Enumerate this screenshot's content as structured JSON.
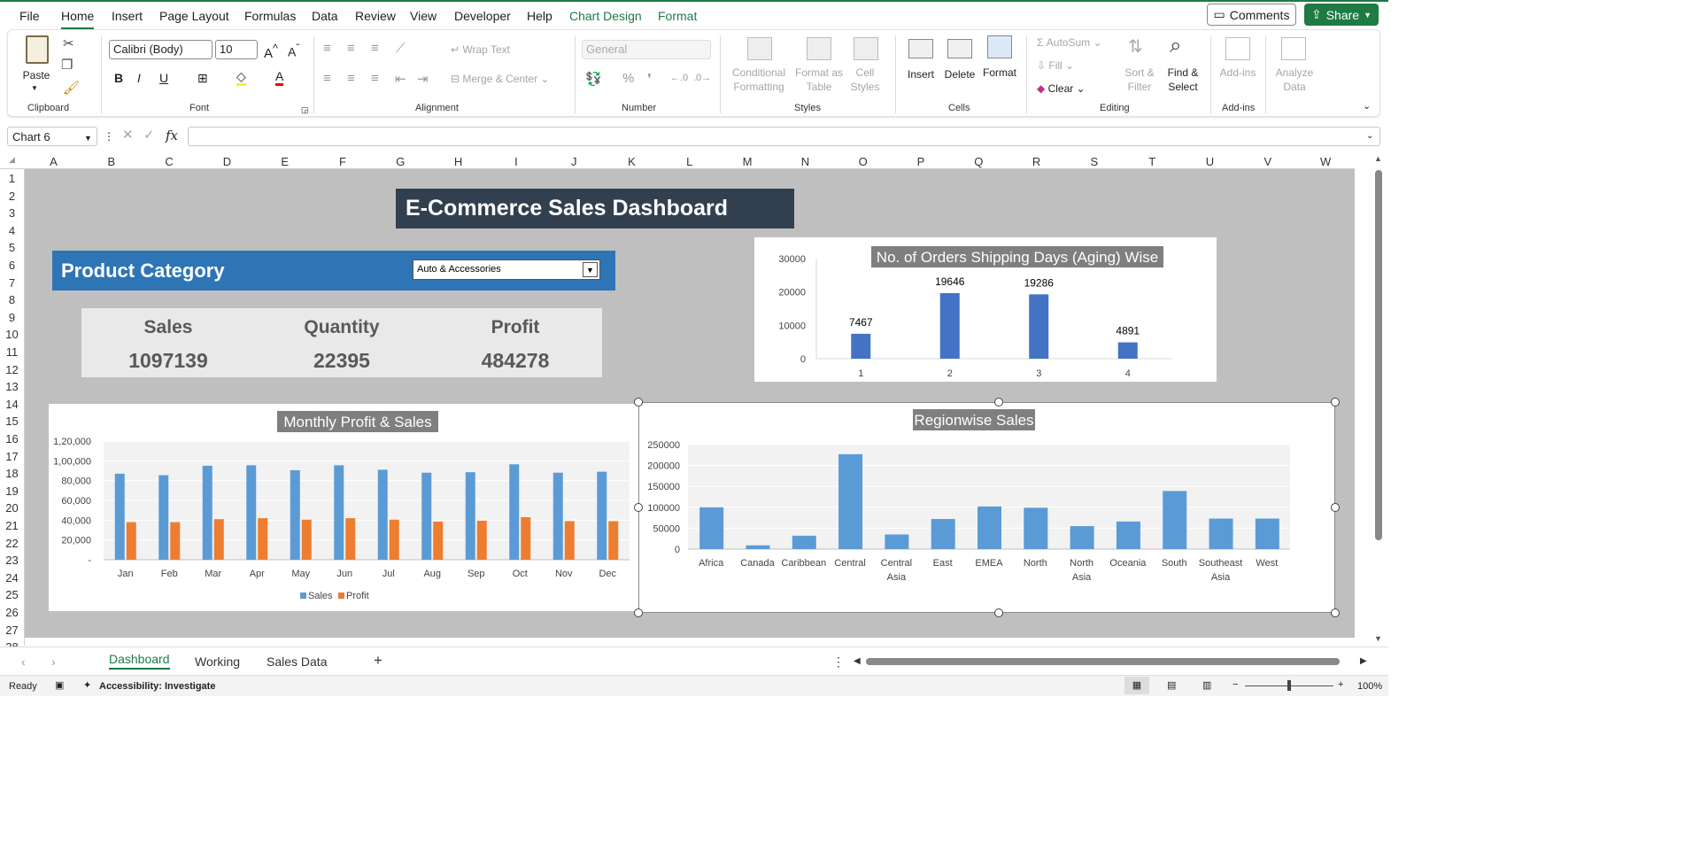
{
  "menu": {
    "tabs": [
      "File",
      "Home",
      "Insert",
      "Page Layout",
      "Formulas",
      "Data",
      "Review",
      "View",
      "Developer",
      "Help",
      "Chart Design",
      "Format"
    ],
    "comments": "Comments",
    "share": "Share"
  },
  "ribbon": {
    "paste": "Paste",
    "clipboard": "Clipboard",
    "font_name": "Calibri (Body)",
    "font_size": "10",
    "font": "Font",
    "wrap_text": "Wrap Text",
    "merge_center": "Merge & Center",
    "alignment": "Alignment",
    "number_format": "General",
    "number": "Number",
    "conditional_formatting": "Conditional Formatting",
    "format_as_table": "Format as Table",
    "cell_styles": "Cell Styles",
    "styles": "Styles",
    "insert": "Insert",
    "delete": "Delete",
    "format": "Format",
    "cells": "Cells",
    "autosum": "AutoSum",
    "fill": "Fill",
    "clear": "Clear",
    "sort_filter": "Sort & Filter",
    "find_select": "Find & Select",
    "editing": "Editing",
    "add_ins": "Add-ins",
    "add_ins_group": "Add-ins",
    "analyze_data": "Analyze Data"
  },
  "formula_bar": {
    "name_box": "Chart 6",
    "fx": "fx"
  },
  "columns": [
    "A",
    "B",
    "C",
    "D",
    "E",
    "F",
    "G",
    "H",
    "I",
    "J",
    "K",
    "L",
    "M",
    "N",
    "O",
    "P",
    "Q",
    "R",
    "S",
    "T",
    "U",
    "V",
    "W"
  ],
  "rows": [
    "1",
    "2",
    "3",
    "4",
    "5",
    "6",
    "7",
    "8",
    "9",
    "10",
    "11",
    "12",
    "13",
    "14",
    "15",
    "16",
    "17",
    "18",
    "19",
    "20",
    "21",
    "22",
    "23",
    "24",
    "25",
    "26",
    "27",
    "28"
  ],
  "dashboard": {
    "title": "E-Commerce Sales Dashboard",
    "category_label": "Product Category",
    "category_value": "Auto & Accessories",
    "kpis": [
      {
        "label": "Sales",
        "value": "1097139"
      },
      {
        "label": "Quantity",
        "value": "22395"
      },
      {
        "label": "Profit",
        "value": "484278"
      }
    ]
  },
  "chart_data": [
    {
      "type": "bar",
      "title": "No. of Orders Shipping Days (Aging) Wise",
      "categories": [
        "1",
        "2",
        "3",
        "4"
      ],
      "values": [
        7467,
        19646,
        19286,
        4891
      ],
      "ylim": [
        0,
        30000
      ],
      "yticks": [
        "30000",
        "20000",
        "10000",
        "0"
      ],
      "color": "#4472c4"
    },
    {
      "type": "bar",
      "title": "Monthly Profit & Sales",
      "categories": [
        "Jan",
        "Feb",
        "Mar",
        "Apr",
        "May",
        "Jun",
        "Jul",
        "Aug",
        "Sep",
        "Oct",
        "Nov",
        "Dec"
      ],
      "series": [
        {
          "name": "Sales",
          "values": [
            87000,
            85500,
            95000,
            95500,
            90500,
            95500,
            91000,
            88000,
            88500,
            96500,
            88000,
            89000
          ],
          "color": "#5b9bd5"
        },
        {
          "name": "Profit",
          "values": [
            38000,
            38000,
            41000,
            42000,
            40500,
            42000,
            40500,
            38500,
            39500,
            43000,
            39000,
            39000
          ],
          "color": "#ed7d31"
        }
      ],
      "ylim": [
        0,
        120000
      ],
      "yticks": [
        "1,20,000",
        "1,00,000",
        "80,000",
        "60,000",
        "40,000",
        "20,000",
        "-"
      ]
    },
    {
      "type": "bar",
      "title": "Regionwise Sales",
      "categories": [
        "Africa",
        "Canada",
        "Caribbean",
        "Central",
        "Central Asia",
        "East",
        "EMEA",
        "North",
        "North Asia",
        "Oceania",
        "South",
        "Southeast Asia",
        "West"
      ],
      "values": [
        100000,
        9000,
        32000,
        227000,
        35000,
        72000,
        102000,
        99000,
        55000,
        66000,
        139000,
        73000,
        73000
      ],
      "ylim": [
        0,
        250000
      ],
      "yticks": [
        "250000",
        "200000",
        "150000",
        "100000",
        "50000",
        "0"
      ],
      "color": "#5b9bd5"
    }
  ],
  "sheet_tabs": [
    "Dashboard",
    "Working",
    "Sales Data"
  ],
  "status": {
    "ready": "Ready",
    "accessibility": "Accessibility: Investigate",
    "zoom": "100%"
  }
}
